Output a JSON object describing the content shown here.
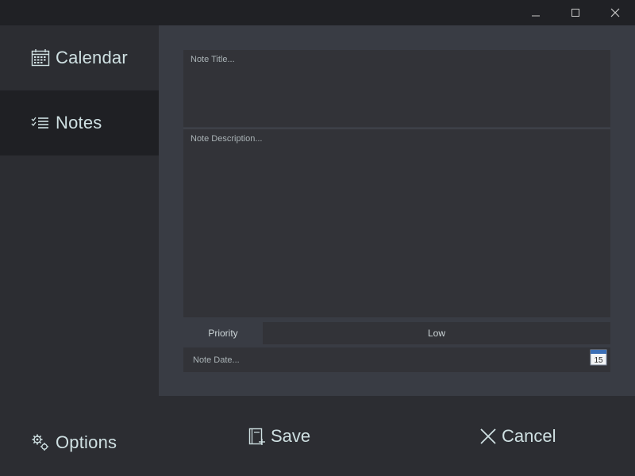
{
  "window": {
    "controls": {
      "minimize": "minimize-icon",
      "maximize": "maximize-icon",
      "close": "close-icon"
    }
  },
  "sidebar": {
    "items": [
      {
        "label": "Calendar",
        "icon": "calendar-icon",
        "selected": false
      },
      {
        "label": "Notes",
        "icon": "checklist-icon",
        "selected": true
      }
    ],
    "options": {
      "label": "Options",
      "icon": "gears-icon"
    }
  },
  "form": {
    "title": {
      "value": "",
      "placeholder": "Note Title..."
    },
    "description": {
      "value": "",
      "placeholder": "Note Description..."
    },
    "priority": {
      "label": "Priority",
      "selected": "Low"
    },
    "date": {
      "value": "",
      "placeholder": "Note Date...",
      "picker_day": "15"
    }
  },
  "actions": {
    "save": {
      "label": "Save",
      "icon": "save-book-icon"
    },
    "cancel": {
      "label": "Cancel",
      "icon": "x-icon"
    }
  },
  "colors": {
    "titlebar": "#202125",
    "sidebar": "#2c2d32",
    "sidebar_selected": "#1f2024",
    "panel": "#393c44",
    "field": "#323338",
    "text": "#cfe0e2"
  }
}
